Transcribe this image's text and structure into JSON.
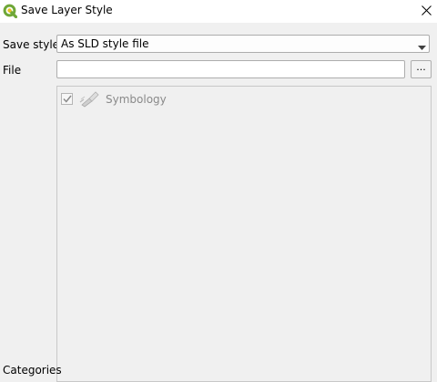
{
  "window": {
    "title": "Save Layer Style"
  },
  "form": {
    "save_style_label": "Save style",
    "save_style_value": "As SLD style file",
    "file_label": "File",
    "file_value": "",
    "browse_label": "...",
    "categories_label": "Categories"
  },
  "categories": {
    "items": [
      {
        "label": "Symbology",
        "checked": true,
        "enabled": false,
        "icon": "symbology-brush-icon"
      }
    ]
  },
  "icons": {
    "app": "qgis-logo-icon",
    "close": "close-icon",
    "dropdown": "chevron-down-icon"
  },
  "colors": {
    "qgis_green": "#6fa737",
    "disabled_text": "#8a8a8a"
  }
}
